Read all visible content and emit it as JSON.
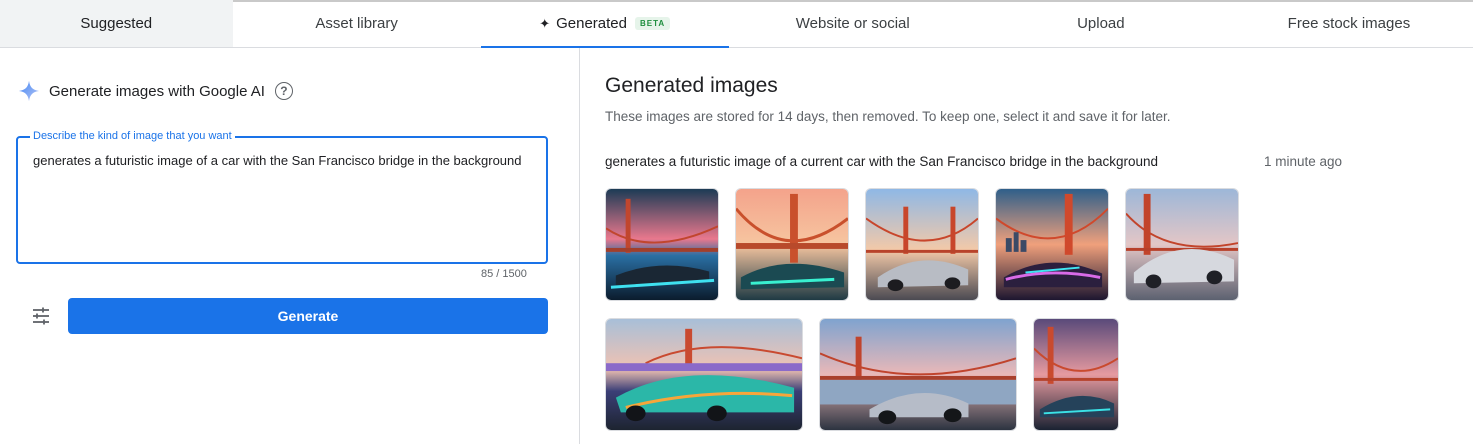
{
  "tabs": [
    {
      "label": "Suggested"
    },
    {
      "label": "Asset library"
    },
    {
      "label": "Generated",
      "badge": "BETA"
    },
    {
      "label": "Website or social"
    },
    {
      "label": "Upload"
    },
    {
      "label": "Free stock images"
    }
  ],
  "left": {
    "heading": "Generate images with Google AI",
    "field_label": "Describe the kind of image that you want",
    "field_value": "generates a futuristic image of a car with the San Francisco bridge in the background",
    "counter": "85 / 1500",
    "generate_label": "Generate"
  },
  "right": {
    "title": "Generated images",
    "subtitle": "These images are stored for 14 days, then removed. To keep one, select it and save it for later.",
    "prompt": "generates a futuristic image of a current car with the San Francisco bridge in the background",
    "time": "1 minute ago"
  },
  "colors": {
    "accent": "#1a73e8",
    "badge_green": "#1e8e3e"
  },
  "icons": [
    "sparkle-icon",
    "help-icon",
    "tune-icon"
  ]
}
